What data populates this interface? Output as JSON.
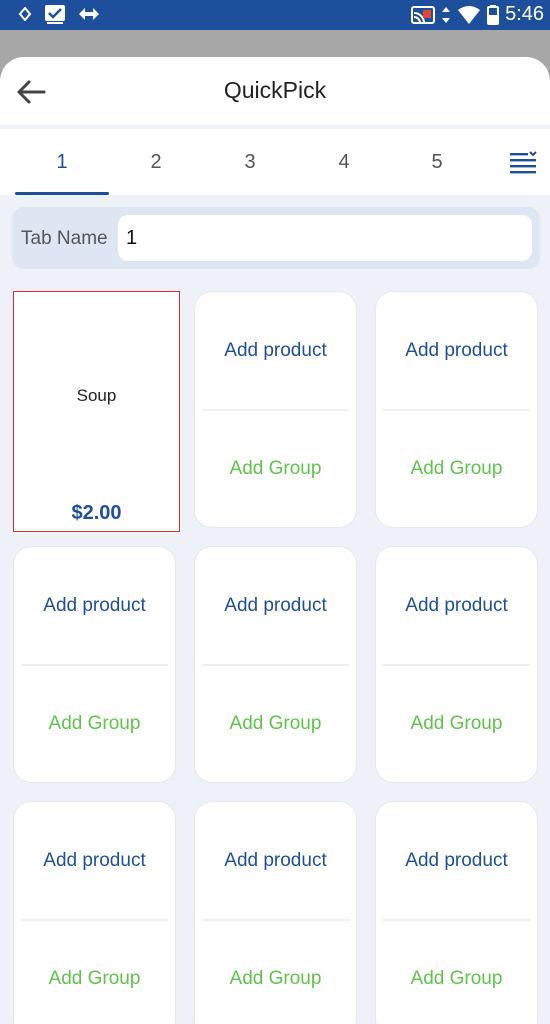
{
  "status_bar": {
    "time": "5:46",
    "left_icons": [
      "location-icon",
      "checkbox-icon",
      "diamond-arrows-icon"
    ],
    "right_icons": [
      "cast-icon",
      "data-arrows-icon",
      "wifi-icon",
      "battery-icon"
    ]
  },
  "header": {
    "title": "QuickPick",
    "back_icon": "arrow-left-icon"
  },
  "tabs": {
    "items": [
      {
        "label": "1",
        "active": true
      },
      {
        "label": "2",
        "active": false
      },
      {
        "label": "3",
        "active": false
      },
      {
        "label": "4",
        "active": false
      },
      {
        "label": "5",
        "active": false
      }
    ],
    "menu_icon": "list-menu-icon"
  },
  "tab_name": {
    "label": "Tab Name",
    "value": "1"
  },
  "grid": {
    "product": {
      "name": "Soup",
      "price": "$2.00"
    },
    "slot_add_product": "Add product",
    "slot_add_group": "Add Group"
  },
  "colors": {
    "primary": "#1e4f9c",
    "group_green": "#5fc34a",
    "selected_border": "#e32b2b",
    "sheet_bg": "#eef1f8"
  }
}
